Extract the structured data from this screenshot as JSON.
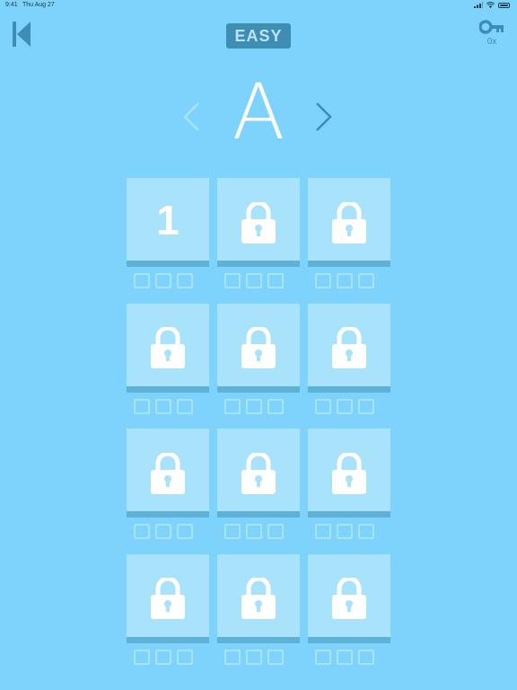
{
  "status_bar": {
    "time": "9:41",
    "date": "Thu Aug 27"
  },
  "header": {
    "difficulty": "EASY",
    "keys_count": "0x"
  },
  "world": {
    "letter": "A"
  },
  "levels": [
    {
      "label": "1",
      "locked": false
    },
    {
      "label": "",
      "locked": true
    },
    {
      "label": "",
      "locked": true
    },
    {
      "label": "",
      "locked": true
    },
    {
      "label": "",
      "locked": true
    },
    {
      "label": "",
      "locked": true
    },
    {
      "label": "",
      "locked": true
    },
    {
      "label": "",
      "locked": true
    },
    {
      "label": "",
      "locked": true
    },
    {
      "label": "",
      "locked": true
    },
    {
      "label": "",
      "locked": true
    },
    {
      "label": "",
      "locked": true
    }
  ],
  "stars_per_level": 3,
  "stars_earned": 0,
  "colors": {
    "background": "#7dd3fb",
    "tile": "#a9e2fb",
    "accent": "#3f8cb4"
  },
  "icons": {
    "back": "back-triangle-icon",
    "key": "key-icon",
    "lock": "padlock-icon",
    "prev": "chevron-left-icon",
    "next": "chevron-right-icon"
  }
}
